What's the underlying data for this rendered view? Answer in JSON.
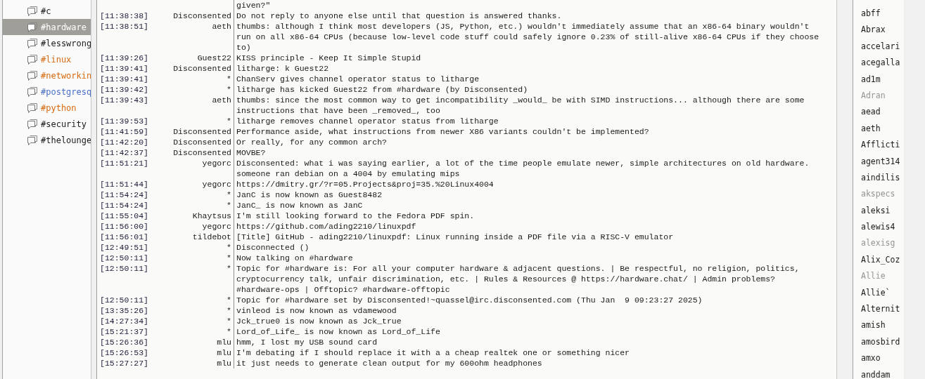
{
  "channels": [
    {
      "name": "#c",
      "selected": false,
      "color": "#202020"
    },
    {
      "name": "#hardware",
      "selected": true,
      "color": "#ffffff"
    },
    {
      "name": "#lesswrong",
      "selected": false,
      "color": "#202020"
    },
    {
      "name": "#linux",
      "selected": false,
      "color": "#d86a10"
    },
    {
      "name": "#networkin",
      "selected": false,
      "color": "#d86a10"
    },
    {
      "name": "#postgresq",
      "selected": false,
      "color": "#4a70c8"
    },
    {
      "name": "#python",
      "selected": false,
      "color": "#d86a10"
    },
    {
      "name": "#security",
      "selected": false,
      "color": "#202020"
    },
    {
      "name": "#thelounge",
      "selected": false,
      "color": "#202020"
    }
  ],
  "messages": [
    {
      "text": "given?\""
    },
    {
      "time": "[11:38:38]",
      "nick": "Disconsented",
      "text": "Do not reply to anyone else until that question is answered thanks."
    },
    {
      "time": "[11:38:51]",
      "nick": "aeth",
      "text": "thumbs: although I think most developers (JS, Python, etc.) wouldn't immediately assume that an x86-64 binary wouldn't run on all x86-64 CPUs (because low-level code stuff could safely ignore 0.23% of still-alive x86-64 CPUs if they choose to)"
    },
    {
      "time": "[11:39:26]",
      "nick": "Guest22",
      "text": "KISS principle - Keep It Simple Stupid"
    },
    {
      "time": "[11:39:41]",
      "nick": "Disconsented",
      "text": "litharge: k Guest22"
    },
    {
      "time": "[11:39:41]",
      "nick": "*",
      "text": "ChanServ gives channel operator status to litharge"
    },
    {
      "time": "[11:39:42]",
      "nick": "*",
      "text": "litharge has kicked Guest22 from #hardware (by Disconsented)"
    },
    {
      "time": "[11:39:43]",
      "nick": "aeth",
      "text": "thumbs: since the most common way to get incompatibility _would_ be with SIMD instructions... although there are some instructions that have been _removed_, too"
    },
    {
      "time": "[11:39:53]",
      "nick": "*",
      "text": "litharge removes channel operator status from litharge"
    },
    {
      "time": "[11:41:59]",
      "nick": "Disconsented",
      "text": "Performance aside, what instructions from newer X86 variants couldn't be implemented?"
    },
    {
      "time": "[11:42:20]",
      "nick": "Disconsented",
      "text": "Or really, for any common arch?"
    },
    {
      "time": "[11:42:37]",
      "nick": "Disconsented",
      "text": "MOVBE?"
    },
    {
      "time": "[11:51:21]",
      "nick": "yegorc",
      "text": "Disconsented: what i was saying earlier, a lot of the time people emulate newer, simple architectures on old hardware. someone ran debian on a 4004 by emulating mips"
    },
    {
      "time": "[11:51:44]",
      "nick": "yegorc",
      "text": "https://dmitry.gr/?r=05.Projects&proj=35.%20Linux4004"
    },
    {
      "time": "[11:54:24]",
      "nick": "*",
      "text": "JanC is now known as Guest8482"
    },
    {
      "time": "[11:54:24]",
      "nick": "*",
      "text": "JanC_ is now known as JanC"
    },
    {
      "time": "[11:55:04]",
      "nick": "Khaytsus",
      "text": "I'm still looking forward to the Fedora PDF spin."
    },
    {
      "time": "[11:56:00]",
      "nick": "yegorc",
      "text": "https://github.com/ading2210/linuxpdf"
    },
    {
      "time": "[11:56:01]",
      "nick": "tildebot",
      "text": "[Title] GitHub - ading2210/linuxpdf: Linux running inside a PDF file via a RISC-V emulator"
    },
    {
      "time": "[12:49:51]",
      "nick": "*",
      "text": "Disconnected ()"
    },
    {
      "time": "[12:50:11]",
      "nick": "*",
      "text": "Now talking on #hardware"
    },
    {
      "time": "[12:50:11]",
      "nick": "*",
      "text": "Topic for #hardware is: For all your computer hardware & adjacent questions. | Be respectful, no religion, politics, cryptocurrency talk, unfair discrimination, etc. | Rules & Resources @ https://hardware.chat/ | Admin problems? #hardware-ops | Offtopic? #hardware-offtopic"
    },
    {
      "time": "[12:50:11]",
      "nick": "*",
      "text": "Topic for #hardware set by Disconsented!~quassel@irc.disconsented.com (Thu Jan  9 09:23:27 2025)"
    },
    {
      "time": "[13:35:26]",
      "nick": "*",
      "text": "vinleod is now known as vdamewood"
    },
    {
      "time": "[14:27:34]",
      "nick": "*",
      "text": "Jck_true0 is now known as Jck_true"
    },
    {
      "time": "[15:21:37]",
      "nick": "*",
      "text": "Lord_of_Life_ is now known as Lord_of_Life"
    },
    {
      "time": "[15:26:36]",
      "nick": "mlu",
      "text": "hmm, I lost my USB sound card"
    },
    {
      "time": "[15:26:53]",
      "nick": "mlu",
      "text": "I'm debating if I should replace it with a a cheap realtek one or something nicer"
    },
    {
      "time": "[15:27:27]",
      "nick": "mlu",
      "text": "it just needs to generate clean output for my 600ohm headphones"
    }
  ],
  "users": [
    {
      "nick": "abff",
      "away": false
    },
    {
      "nick": "Abrax",
      "away": false
    },
    {
      "nick": "accelari",
      "away": false
    },
    {
      "nick": "acegalla",
      "away": false
    },
    {
      "nick": "ad1m",
      "away": false
    },
    {
      "nick": "Adran",
      "away": true
    },
    {
      "nick": "aead",
      "away": false
    },
    {
      "nick": "aeth",
      "away": false
    },
    {
      "nick": "Afflicti",
      "away": false
    },
    {
      "nick": "agent314",
      "away": false
    },
    {
      "nick": "aindilis",
      "away": false
    },
    {
      "nick": "akspecs",
      "away": true
    },
    {
      "nick": "aleksi",
      "away": false
    },
    {
      "nick": "alewis4",
      "away": false
    },
    {
      "nick": "alexisg",
      "away": true
    },
    {
      "nick": "Alix_Coz",
      "away": false
    },
    {
      "nick": "Allie",
      "away": true
    },
    {
      "nick": "Allie`",
      "away": false
    },
    {
      "nick": "Alternit",
      "away": false
    },
    {
      "nick": "amish",
      "away": false
    },
    {
      "nick": "amosbird",
      "away": false
    },
    {
      "nick": "amxo",
      "away": false
    },
    {
      "nick": "anddam",
      "away": false
    }
  ]
}
